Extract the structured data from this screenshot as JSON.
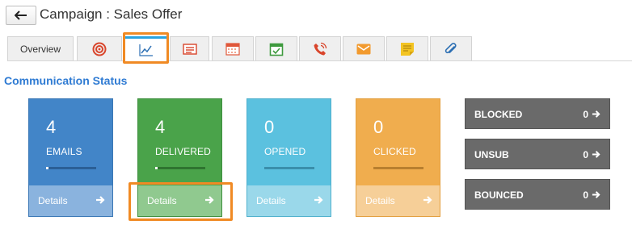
{
  "header": {
    "back_icon": "arrow-left-icon",
    "title": "Campaign : Sales Offer"
  },
  "tabs": [
    {
      "label": "Overview",
      "icon": null
    },
    {
      "label": "",
      "icon": "target-icon"
    },
    {
      "label": "",
      "icon": "line-chart-icon",
      "active": true
    },
    {
      "label": "",
      "icon": "list-card-icon"
    },
    {
      "label": "",
      "icon": "calendar-grid-icon"
    },
    {
      "label": "",
      "icon": "calendar-check-icon"
    },
    {
      "label": "",
      "icon": "phone-call-icon"
    },
    {
      "label": "",
      "icon": "envelope-icon"
    },
    {
      "label": "",
      "icon": "sticky-note-icon"
    },
    {
      "label": "",
      "icon": "paperclip-icon"
    }
  ],
  "section": {
    "title": "Communication Status"
  },
  "cards": [
    {
      "count": "4",
      "label": "EMAILS",
      "details": "Details",
      "color": "#4285c8",
      "footer_color": "#8ab3de",
      "bar_color": "#2b5f96",
      "progress": 0.05
    },
    {
      "count": "4",
      "label": "DELIVERED",
      "details": "Details",
      "color": "#4aa34a",
      "footer_color": "#90c98f",
      "bar_color": "#2f7430",
      "progress": 0.05
    },
    {
      "count": "0",
      "label": "OPENED",
      "details": "Details",
      "color": "#5bc1df",
      "footer_color": "#9ad8ea",
      "bar_color": "#3a8fab",
      "progress": 0
    },
    {
      "count": "0",
      "label": "CLICKED",
      "details": "Details",
      "color": "#f0ad4e",
      "footer_color": "#f6cf98",
      "bar_color": "#b87f2f",
      "progress": 0
    }
  ],
  "side_buttons": [
    {
      "label": "BLOCKED",
      "count": "0"
    },
    {
      "label": "UNSUB",
      "count": "0"
    },
    {
      "label": "BOUNCED",
      "count": "0"
    }
  ],
  "colors": {
    "accent_blue": "#2f7bd3",
    "highlight_orange": "#f08a24",
    "active_tab_border": "#2aa3e0"
  }
}
